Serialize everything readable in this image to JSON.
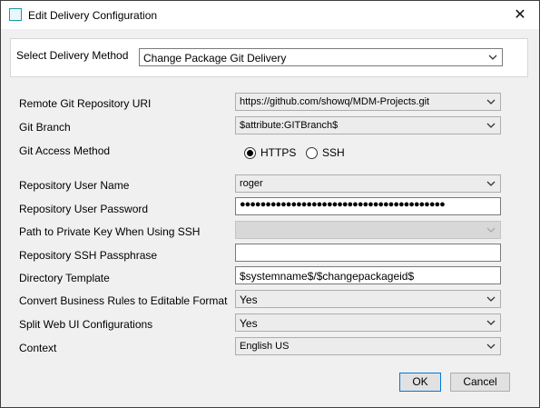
{
  "window": {
    "title": "Edit Delivery Configuration",
    "close_glyph": "✕"
  },
  "method": {
    "label": "Select Delivery Method",
    "value": "Change Package Git Delivery"
  },
  "fields": {
    "remote_uri": {
      "label": "Remote Git Repository URI",
      "value": "https://github.com/showq/MDM-Projects.git"
    },
    "branch": {
      "label": "Git Branch",
      "value": "$attribute:GITBranch$"
    },
    "access_method": {
      "label": "Git Access Method",
      "options": [
        "HTTPS",
        "SSH"
      ],
      "selected": "HTTPS"
    },
    "user_name": {
      "label": "Repository User Name",
      "value": "roger"
    },
    "user_password": {
      "label": "Repository User Password",
      "value": "●●●●●●●●●●●●●●●●●●●●●●●●●●●●●●●●●●●●●●●●"
    },
    "private_key": {
      "label": "Path to Private Key When Using SSH",
      "value": ""
    },
    "ssh_passphrase": {
      "label": "Repository SSH Passphrase",
      "value": ""
    },
    "directory_template": {
      "label": "Directory Template",
      "value": "$systemname$/$changepackageid$"
    },
    "convert_rules": {
      "label": "Convert Business Rules to Editable Format",
      "value": "Yes"
    },
    "split_web_ui": {
      "label": "Split Web UI Configurations",
      "value": "Yes"
    },
    "context": {
      "label": "Context",
      "value": "English US"
    }
  },
  "buttons": {
    "ok": "OK",
    "cancel": "Cancel"
  },
  "icons": {
    "app": "app-window-icon",
    "close": "close-icon",
    "dropdown": "chevron-down-icon"
  }
}
